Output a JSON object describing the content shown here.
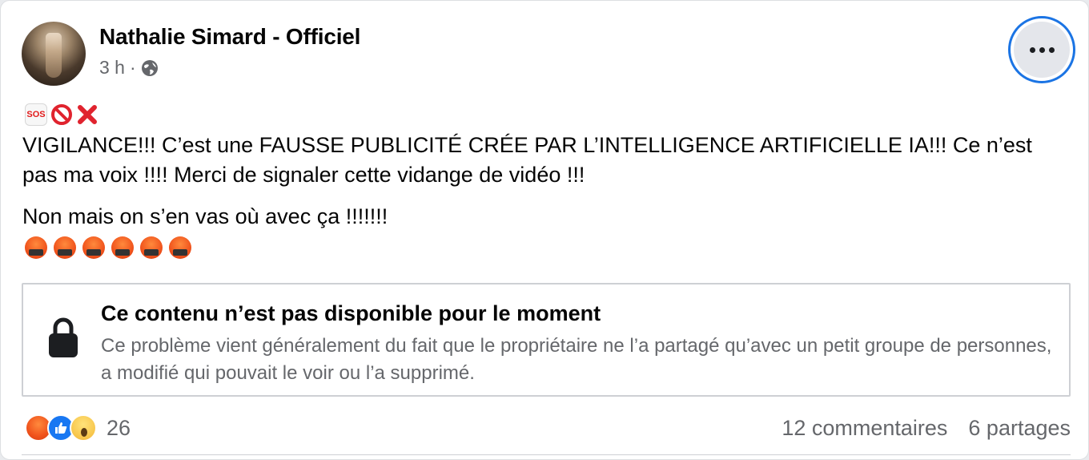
{
  "post": {
    "author": "Nathalie Simard - Officiel",
    "time": "3 h",
    "separator": "·",
    "privacy_icon": "globe-icon",
    "more_icon": "more-horizontal-icon",
    "lead_emojis": [
      "sos-icon",
      "prohibited-icon",
      "cross-mark-icon"
    ],
    "sos_label": "SOS",
    "text_line1": "VIGILANCE!!! C’est une FAUSSE PUBLICITÉ CRÉE PAR L’INTELLIGENCE ARTIFICIELLE IA!!! Ce n’est pas ma voix !!!! Merci de signaler cette vidange de vidéo !!!",
    "text_line2": "Non mais on s’en vas où avec ça !!!!!!!",
    "angry_emoji_count": 6
  },
  "unavailable": {
    "title": "Ce contenu n’est pas disponible pour le moment",
    "description": "Ce problème vient généralement du fait que le propriétaire ne l’a partagé qu’avec un petit groupe de personnes, a modifié qui pouvait le voir ou l’a supprimé.",
    "icon": "lock-icon"
  },
  "footer": {
    "reactions": [
      "angry",
      "like",
      "wow"
    ],
    "reaction_count": "26",
    "comments": "12 commentaires",
    "shares": "6 partages"
  },
  "colors": {
    "accent": "#1b74e4",
    "secondary_text": "#65676b",
    "like_blue": "#1877f2",
    "angry_orange": "#f0531c"
  }
}
